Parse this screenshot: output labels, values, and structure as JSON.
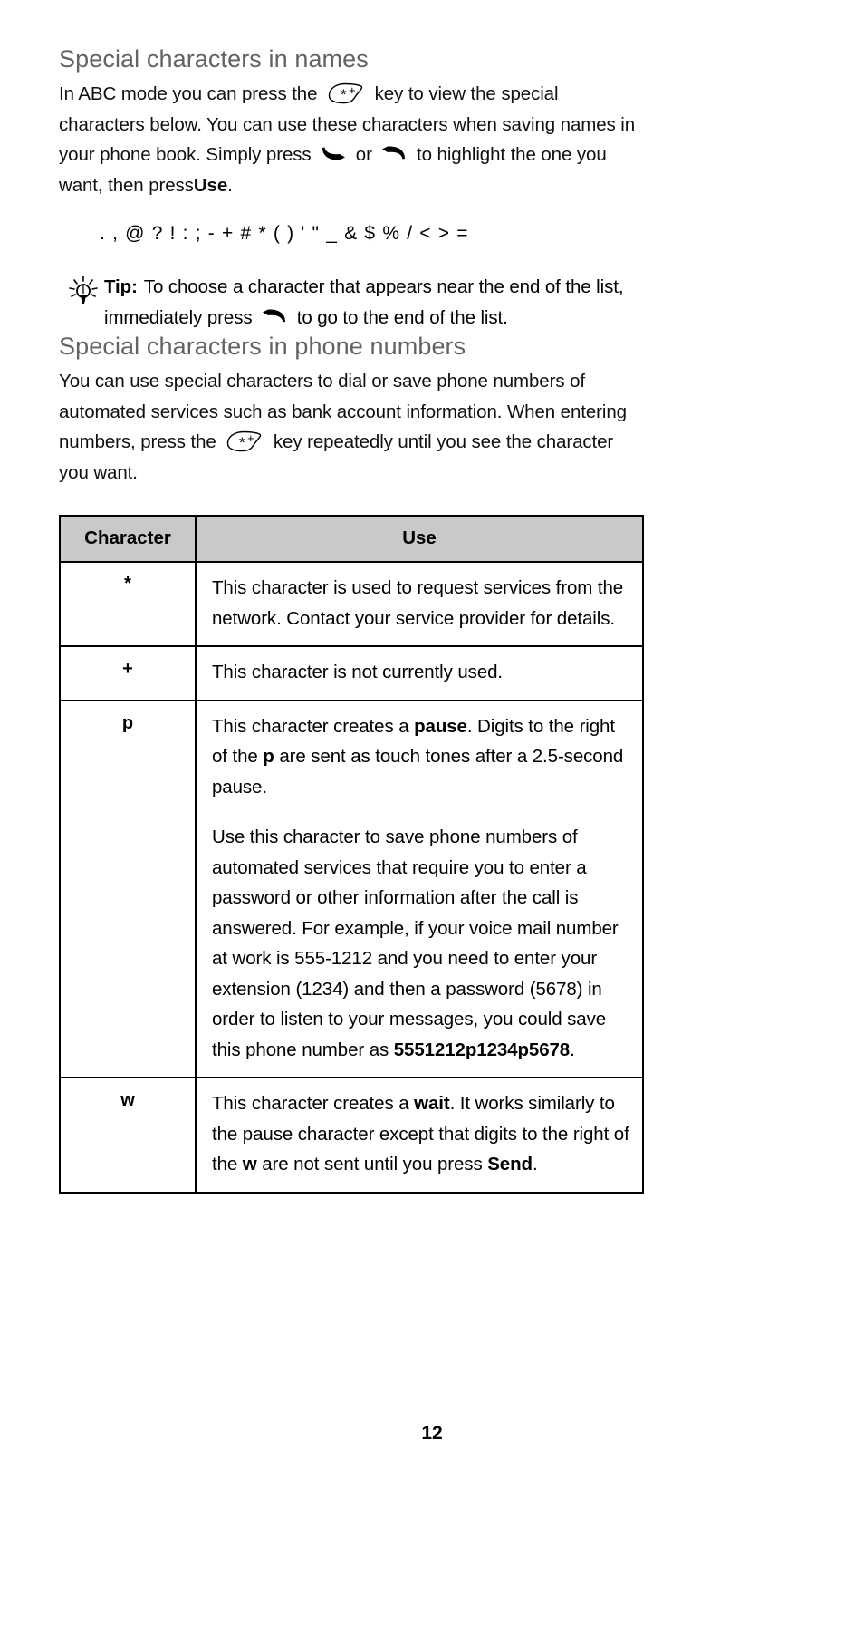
{
  "document": {
    "page_number": "12",
    "heading_color": "#636363",
    "table_header_bg": "#c9c9c9"
  },
  "section_names": {
    "heading": "Special characters in names",
    "body_part_1": "In ABC mode you can press the",
    "key_icon": "star-plus-key-icon",
    "body_part_2": "key to view the special characters below. You can use these characters when saving names in your phone book. Simply press",
    "arrow_down_icon": "scroll-down-arrow-icon",
    "body_part_3": "or",
    "arrow_up_icon": "scroll-up-arrow-icon",
    "body_part_4": "to highlight the one you want, then press",
    "use_label": "Use",
    "body_part_5": ".",
    "character_list": ". , @ ? ! : ; - + # * ( ) ' \" _ & $ % / < > ="
  },
  "tip": {
    "icon": "lightbulb-icon",
    "label": "Tip:",
    "text_part_1": "To choose a character that appears near the end of the list, immediately press",
    "arrow_icon": "scroll-up-arrow-icon",
    "text_part_2": "to go to the end of the list."
  },
  "section_phone_numbers": {
    "heading": "Special characters in phone numbers",
    "body_part_1": "You can use special characters to dial or save phone numbers of automated services such as bank account information. When entering numbers, press the",
    "key_icon": "star-plus-key-icon",
    "body_part_2": "key repeatedly until you see the character you want."
  },
  "table": {
    "headers": [
      "Character",
      "Use"
    ],
    "rows": [
      {
        "character": "*",
        "paragraphs": [
          {
            "segments": [
              {
                "text": "This character is used to request services from the network. Contact your service provider for details.",
                "bold": false
              }
            ]
          }
        ]
      },
      {
        "character": "+",
        "paragraphs": [
          {
            "segments": [
              {
                "text": "This character is not currently used.",
                "bold": false
              }
            ]
          }
        ]
      },
      {
        "character": "p",
        "paragraphs": [
          {
            "segments": [
              {
                "text": "This character creates a ",
                "bold": false
              },
              {
                "text": "pause",
                "bold": true
              },
              {
                "text": ". Digits to the right of the ",
                "bold": false
              },
              {
                "text": "p",
                "bold": true
              },
              {
                "text": " are sent as touch tones after a 2.5-second pause.",
                "bold": false
              }
            ]
          },
          {
            "segments": [
              {
                "text": "Use this character to save phone numbers of automated services that require you to enter a password or other information after the call is answered. For example, if your voice mail number at work is 555-1212 and you need to enter your extension (1234) and then a password (5678) in order to listen to your messages, you could save this phone number as ",
                "bold": false
              },
              {
                "text": "5551212p1234p5678",
                "bold": true
              },
              {
                "text": ".",
                "bold": false
              }
            ]
          }
        ]
      },
      {
        "character": "w",
        "paragraphs": [
          {
            "segments": [
              {
                "text": "This character creates a ",
                "bold": false
              },
              {
                "text": "wait",
                "bold": true
              },
              {
                "text": ". It works similarly to the pause character except that digits to the right of the ",
                "bold": false
              },
              {
                "text": "w",
                "bold": true
              },
              {
                "text": " are not sent until you press ",
                "bold": false
              },
              {
                "text": "Send",
                "bold": true
              },
              {
                "text": ".",
                "bold": false
              }
            ]
          }
        ]
      }
    ]
  }
}
